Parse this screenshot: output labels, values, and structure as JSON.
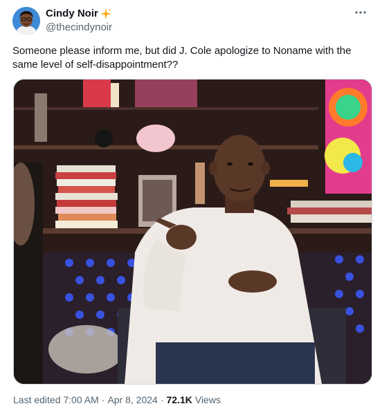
{
  "author": {
    "display_name": "Cindy Noir",
    "handle": "@thecindynoir",
    "verified_badge_icon": "sparkle-icon",
    "badge_color": "#ffad1f"
  },
  "more_icon": "ellipsis-icon",
  "tweet": {
    "text": "Someone please inform me, but did J. Cole apologize to Noname with the same level of self-disappointment??"
  },
  "media": {
    "icon": "video-still-image"
  },
  "meta": {
    "edited_label": "Last edited 7:00 AM",
    "separator": "·",
    "date": "Apr 8, 2024",
    "views_count": "72.1K",
    "views_label": "Views"
  },
  "colors": {
    "text_primary": "#0f1419",
    "text_secondary": "#536471",
    "border": "#cfd9de"
  }
}
